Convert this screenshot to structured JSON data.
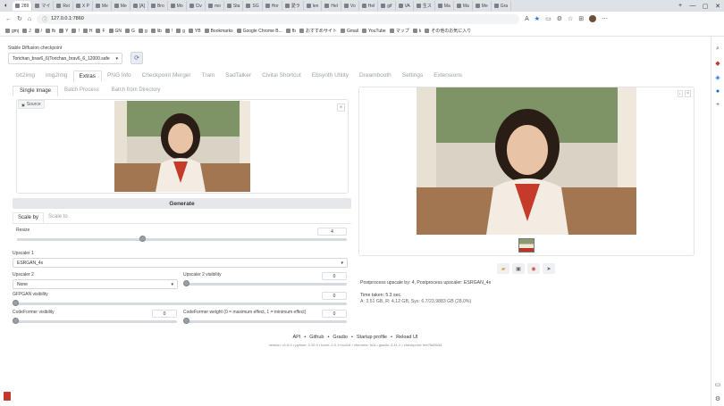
{
  "browser": {
    "tabs": [
      "289",
      "マイ",
      "Rei",
      "X P",
      "Me",
      "Me",
      "[A]",
      "Bro",
      "Mo",
      "Civ",
      "mo",
      "Sta",
      "SG",
      "Hor",
      "愛ラ",
      "len",
      "Hel",
      "Vo",
      "Hel",
      "gif",
      "VA",
      "生ス",
      "Ma",
      "Ma",
      "Me",
      "Gra"
    ],
    "active_tab_label": "",
    "address": "127.0.0.1:7860",
    "bookmarks": [
      "gmj",
      "J",
      "/",
      "fb",
      "Y",
      "!",
      "H",
      "F",
      "GN",
      "G",
      "g",
      "lib",
      "!",
      "g",
      "YB",
      "Bookmarks",
      "Google Chrome B...",
      "fb",
      "おすすめサイト",
      "Gmail",
      "YouTube",
      "マップ",
      "k",
      "その他のお気に入り"
    ]
  },
  "app": {
    "checkpoint_label": "Stable Diffusion checkpoint",
    "checkpoint_value": "Torichan_brav6_6(Torichan_brav6_6_12000.safe",
    "main_tabs": [
      "txt2img",
      "img2img",
      "Extras",
      "PNG Info",
      "Checkpoint Merger",
      "Train",
      "SadTalker",
      "Civitai Shortcut",
      "Ebsynth Utility",
      "Dreambooth",
      "Settings",
      "Extensions"
    ],
    "sub_tabs": [
      "Single Image",
      "Batch Process",
      "Batch from Directory"
    ],
    "source_label": "Source",
    "generate_label": "Generate",
    "scale_tabs": [
      "Scale by",
      "Scale to"
    ],
    "resize_label": "Resize",
    "resize_value": "4",
    "resize_fraction": 0.38,
    "upscaler1_label": "Upscaler 1",
    "upscaler1_value": "ESRGAN_4x",
    "upscaler2_label": "Upscaler 2",
    "upscaler2_value": "None",
    "upscaler2_vis_label": "Upscaler 2 visibility",
    "upscaler2_vis_value": "0",
    "gfpgan_label": "GFPGAN visibility",
    "gfpgan_value": "0",
    "codeformer_vis_label": "CodeFormer visibility",
    "codeformer_vis_value": "0",
    "codeformer_weight_label": "CodeFormer weight (0 = maximum effect, 1 = minimum effect)",
    "codeformer_weight_value": "0"
  },
  "output": {
    "postprocess_text": "Postprocess upscale by: 4, Postprocess upscaler: ESRGAN_4x",
    "time_taken": "Time taken: 5.3 sec.",
    "memory_text": "A: 3.51 GB, R: 4.12 GB, Sys: 6.7/23.9883 GB (28.0%)",
    "action_icons": [
      "folder-icon",
      "save-icon",
      "zip-icon",
      "send-icon"
    ]
  },
  "footer": {
    "links": [
      "API",
      "Github",
      "Gradio",
      "Startup profile",
      "Reload UI"
    ],
    "versions": "version: v1.6.0  •  python: 3.10.9  •  torch: 2.0.1+cu118  •  xformers: N/A  •  gradio: 3.41.2  •  checkpoint: fee76d9b34"
  },
  "colors": {
    "accent": "#4a6fa5",
    "panel_border": "#e2e4e7"
  }
}
